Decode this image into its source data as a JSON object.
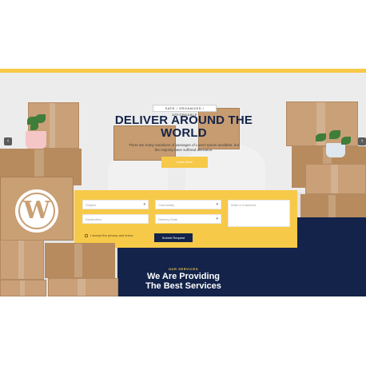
{
  "hero": {
    "badge": "SAFE / ORGANIZED / AFFORDABLE",
    "title": "DELIVER AROUND THE WORLD",
    "text": "There are many variations of passages of Lorem Ipsum available, but the majority have suffered alteration.",
    "button_label": "Learn More",
    "prev_arrow": "‹",
    "next_arrow": "›"
  },
  "logo": {
    "glyph": "W"
  },
  "form": {
    "fields": [
      {
        "placeholder": "Subject"
      },
      {
        "placeholder": "Commodity"
      },
      {
        "placeholder": "Destination"
      },
      {
        "placeholder": "Delivery Date"
      }
    ],
    "textarea_placeholder": "Write a Comment",
    "checkbox_label": "I accept the privacy and terms",
    "submit_label": "Submit Request"
  },
  "services": {
    "label": "OUR SERVICES",
    "title_line1": "We Are Providing",
    "title_line2": "The Best Services"
  },
  "colors": {
    "accent": "#f7c948",
    "navy": "#13234a",
    "cardboard": "#c9a078"
  }
}
